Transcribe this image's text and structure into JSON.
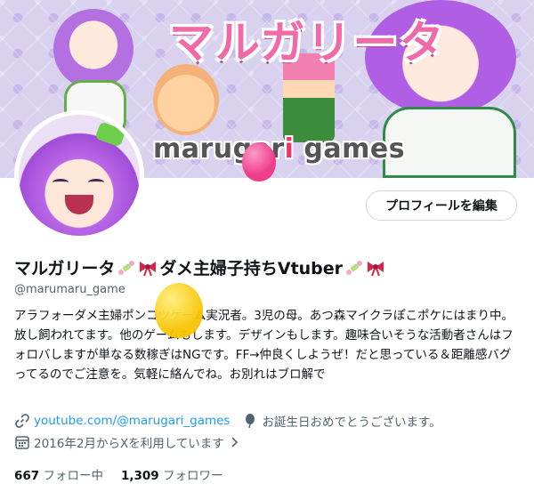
{
  "banner": {
    "title": "マルガリータ",
    "brand_left": "marugar",
    "brand_o": "i",
    "brand_right": " games"
  },
  "profile": {
    "edit_button": "プロフィールを編集",
    "display_name": "マルガリータ",
    "display_name_mid": "ダメ主婦子持ちVtuber",
    "handle": "@marumaru_game",
    "bio": "アラフォーダメ主婦ポンコツゲーム実況者。3児の母。あつ森マイクラぽこポケにはまり中。放し飼われてます。他のゲームもします。デザインもします。趣味合いそうな活動者さんはフォロバしますが単なる数稼ぎはNGです。FF→仲良くしようぜ！だと思っている＆距離感バグってるのでご注意を。気軽に絡んでね。お別れはブロ解で",
    "link_text": "youtube.com/@marugari_games",
    "birthday_text": "お誕生日おめでとうございます。",
    "joined_text": "2016年2月からXを利用しています",
    "following_count": "667",
    "following_label": "フォロー中",
    "followers_count": "1,309",
    "followers_label": "フォロワー"
  },
  "icons": [
    "link-icon",
    "balloon-icon",
    "calendar-icon",
    "chevron-right-icon",
    "ribbon-icon",
    "candy-icon"
  ]
}
